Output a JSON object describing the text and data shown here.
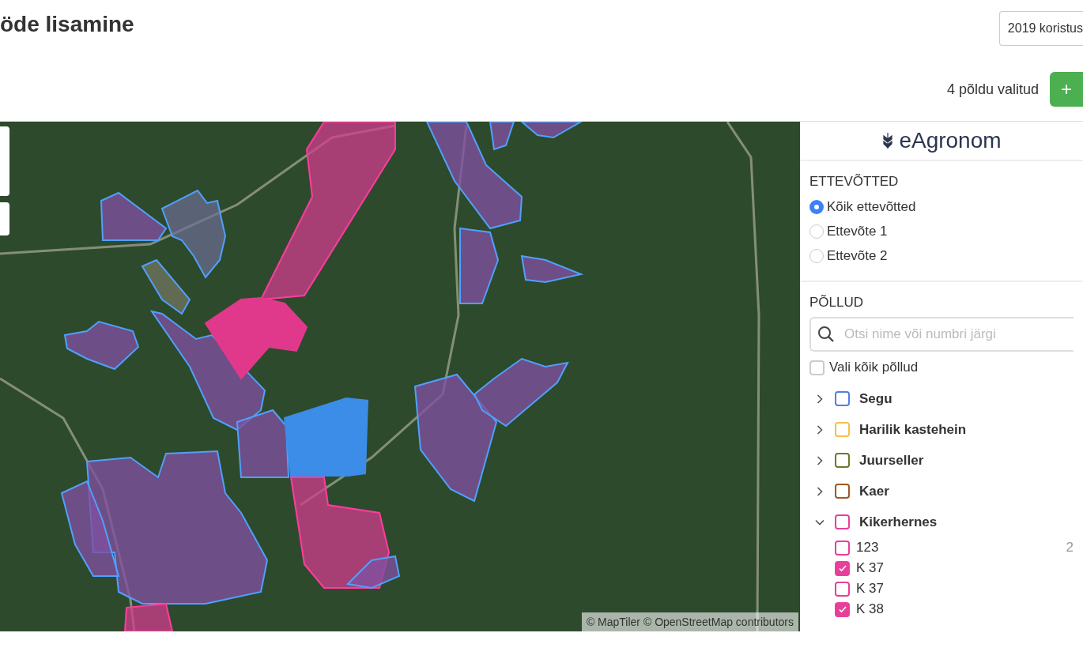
{
  "page": {
    "title": "öde lisamine"
  },
  "season_select": {
    "value": "2019 koristus"
  },
  "selection_count": "4 põldu valitud",
  "add_button": {
    "label": "+"
  },
  "map": {
    "attribution": "© MapTiler © OpenStreetMap contributors"
  },
  "sidebar": {
    "logo": "eAgronom",
    "companies": {
      "heading": "ETTEVÕTTED",
      "options": [
        {
          "label": "Kõik ettevõtted",
          "selected": true
        },
        {
          "label": "Ettevõte 1",
          "selected": false
        },
        {
          "label": "Ettevõte 2",
          "selected": false
        }
      ]
    },
    "fields": {
      "heading": "PÕLLUD",
      "search": {
        "placeholder": "Otsi nime või numbri järgi"
      },
      "select_all": {
        "label": "Vali kõik põllud",
        "checked": false
      },
      "crops": [
        {
          "name": "Segu",
          "color": "#4f7fe6",
          "expanded": false,
          "checked": false
        },
        {
          "name": "Harilik kastehein",
          "color": "#f5c04a",
          "expanded": false,
          "checked": false
        },
        {
          "name": "Juurseller",
          "color": "#6b7a2a",
          "expanded": false,
          "checked": false
        },
        {
          "name": "Kaer",
          "color": "#a0562a",
          "expanded": false,
          "checked": false
        },
        {
          "name": "Kikerhernes",
          "color": "#e8409a",
          "expanded": true,
          "checked": false,
          "children": [
            {
              "name": "123",
              "checked": false,
              "column_2": "2"
            },
            {
              "name": "K 37",
              "checked": true
            },
            {
              "name": "K 37",
              "checked": false
            },
            {
              "name": "K 38",
              "checked": true
            }
          ]
        }
      ]
    }
  }
}
